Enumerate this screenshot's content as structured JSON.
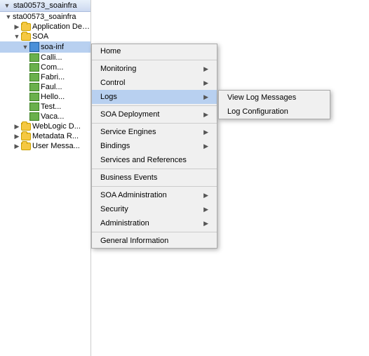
{
  "window": {
    "title": "sta00573_soainfra"
  },
  "tree": {
    "header": "sta00573_soainfra",
    "nodes": [
      {
        "id": "root",
        "label": "sta00573_soainfra",
        "indent": 0,
        "type": "root",
        "expanded": true
      },
      {
        "id": "app-deployments",
        "label": "Application Deployments",
        "indent": 1,
        "type": "folder",
        "expanded": false
      },
      {
        "id": "soa",
        "label": "SOA",
        "indent": 1,
        "type": "folder",
        "expanded": true
      },
      {
        "id": "soa-inf",
        "label": "soa-inf",
        "indent": 2,
        "type": "soa",
        "expanded": true,
        "selected": true
      },
      {
        "id": "calli",
        "label": "Calli...",
        "indent": 3,
        "type": "composite"
      },
      {
        "id": "com",
        "label": "Com...",
        "indent": 3,
        "type": "composite"
      },
      {
        "id": "fabri",
        "label": "Fabri...",
        "indent": 3,
        "type": "composite"
      },
      {
        "id": "faul",
        "label": "Faul...",
        "indent": 3,
        "type": "composite"
      },
      {
        "id": "hello",
        "label": "Hello...",
        "indent": 3,
        "type": "composite"
      },
      {
        "id": "test",
        "label": "Test...",
        "indent": 3,
        "type": "composite"
      },
      {
        "id": "vaca",
        "label": "Vaca...",
        "indent": 3,
        "type": "composite"
      },
      {
        "id": "weblogic-d",
        "label": "WebLogic D...",
        "indent": 1,
        "type": "folder",
        "expanded": false
      },
      {
        "id": "metadata-r",
        "label": "Metadata R...",
        "indent": 1,
        "type": "folder",
        "expanded": false
      },
      {
        "id": "user-messa",
        "label": "User Messa...",
        "indent": 1,
        "type": "folder",
        "expanded": false
      }
    ]
  },
  "contextMenu": {
    "items": [
      {
        "id": "home",
        "label": "Home",
        "hasSubmenu": false
      },
      {
        "id": "sep1",
        "type": "separator"
      },
      {
        "id": "monitoring",
        "label": "Monitoring",
        "hasSubmenu": true
      },
      {
        "id": "control",
        "label": "Control",
        "hasSubmenu": true
      },
      {
        "id": "logs",
        "label": "Logs",
        "hasSubmenu": true,
        "highlighted": true
      },
      {
        "id": "sep2",
        "type": "separator"
      },
      {
        "id": "soa-deployment",
        "label": "SOA Deployment",
        "hasSubmenu": true
      },
      {
        "id": "sep3",
        "type": "separator"
      },
      {
        "id": "service-engines",
        "label": "Service Engines",
        "hasSubmenu": true
      },
      {
        "id": "bindings",
        "label": "Bindings",
        "hasSubmenu": true
      },
      {
        "id": "services-references",
        "label": "Services and References",
        "hasSubmenu": false
      },
      {
        "id": "sep4",
        "type": "separator"
      },
      {
        "id": "business-events",
        "label": "Business Events",
        "hasSubmenu": false
      },
      {
        "id": "sep5",
        "type": "separator"
      },
      {
        "id": "soa-administration",
        "label": "SOA Administration",
        "hasSubmenu": true
      },
      {
        "id": "security",
        "label": "Security",
        "hasSubmenu": true
      },
      {
        "id": "administration",
        "label": "Administration",
        "hasSubmenu": true
      },
      {
        "id": "sep6",
        "type": "separator"
      },
      {
        "id": "general-information",
        "label": "General Information",
        "hasSubmenu": false
      }
    ],
    "logsSubmenu": [
      {
        "id": "view-log-messages",
        "label": "View Log Messages"
      },
      {
        "id": "log-configuration",
        "label": "Log Configuration"
      }
    ]
  }
}
